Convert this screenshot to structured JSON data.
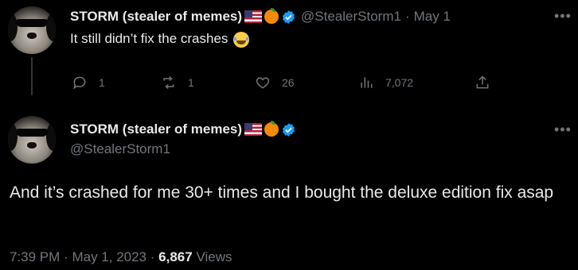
{
  "reply_tweet": {
    "author_name": "STORM (stealer of memes)",
    "handle": "@StealerStorm1",
    "separator": "·",
    "date": "May 1",
    "text": "It still didn’t fix the crashes",
    "emoji": "face-with-tears-of-joy",
    "actions": {
      "replies": "1",
      "retweets": "1",
      "likes": "26",
      "views": "7,072"
    }
  },
  "main_tweet": {
    "author_name": "STORM (stealer of memes)",
    "handle": "@StealerStorm1",
    "text": "And it’s crashed for me 30+ times and I bought the deluxe edition fix asap",
    "time": "7:39 PM",
    "separator": "·",
    "date": "May 1, 2023",
    "views_count": "6,867",
    "views_label": "Views"
  },
  "colors": {
    "background": "#000000",
    "text": "#e7e9ea",
    "muted": "#71767b",
    "verified": "#1d9bf0",
    "thread_line": "#333639"
  },
  "icons": [
    "reply-icon",
    "retweet-icon",
    "like-icon",
    "views-icon",
    "share-icon",
    "more-icon",
    "verified-badge-icon",
    "us-flag-icon",
    "orange-emoji-icon"
  ]
}
